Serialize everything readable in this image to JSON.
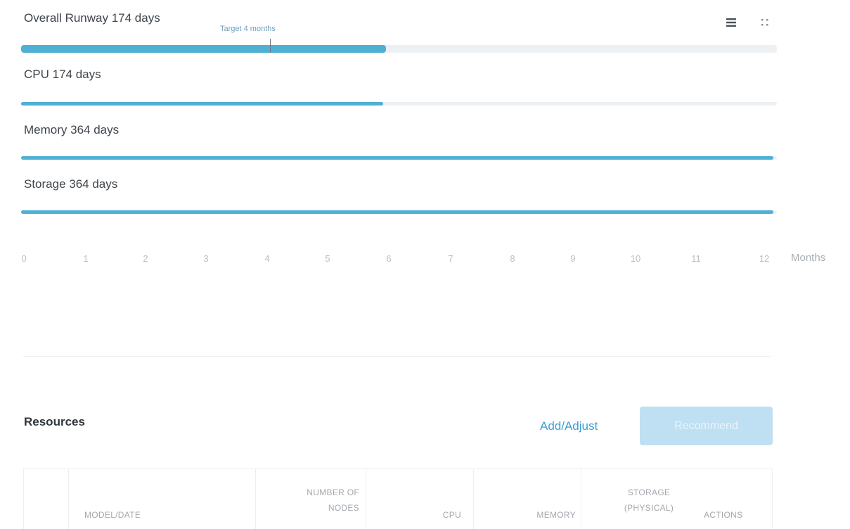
{
  "runway": {
    "overall": {
      "label": "Overall Runway 174 days",
      "progress_fraction": 0.483
    },
    "target_label": "Target 4 months",
    "rows": [
      {
        "label": "CPU 174 days",
        "progress_fraction": 0.479
      },
      {
        "label": "Memory 364 days",
        "progress_fraction": 0.995
      },
      {
        "label": "Storage 364 days",
        "progress_fraction": 0.995
      }
    ],
    "view_toggle": {
      "list_icon": "list-icon",
      "grid_icon": "grid-icon"
    }
  },
  "axis": {
    "ticks": [
      "0",
      "1",
      "2",
      "3",
      "4",
      "5",
      "6",
      "7",
      "8",
      "9",
      "10",
      "11",
      "12"
    ],
    "unit": "Months"
  },
  "resources": {
    "title": "Resources",
    "add_adjust_label": "Add/Adjust",
    "recommend_label": "Recommend",
    "table": {
      "columns": {
        "model_date": "MODEL/DATE",
        "nodes_line1": "NUMBER OF",
        "nodes_line2": "NODES",
        "cpu": "CPU",
        "memory": "MEMORY",
        "storage_line1": "STORAGE",
        "storage_line2": "(PHYSICAL)",
        "actions": "ACTIONS"
      }
    }
  },
  "colors": {
    "bar_fill": "#4fb0d4",
    "track": "#eef1f3",
    "link": "#3a9dd6",
    "primary_disabled": "#bfe0f2"
  }
}
